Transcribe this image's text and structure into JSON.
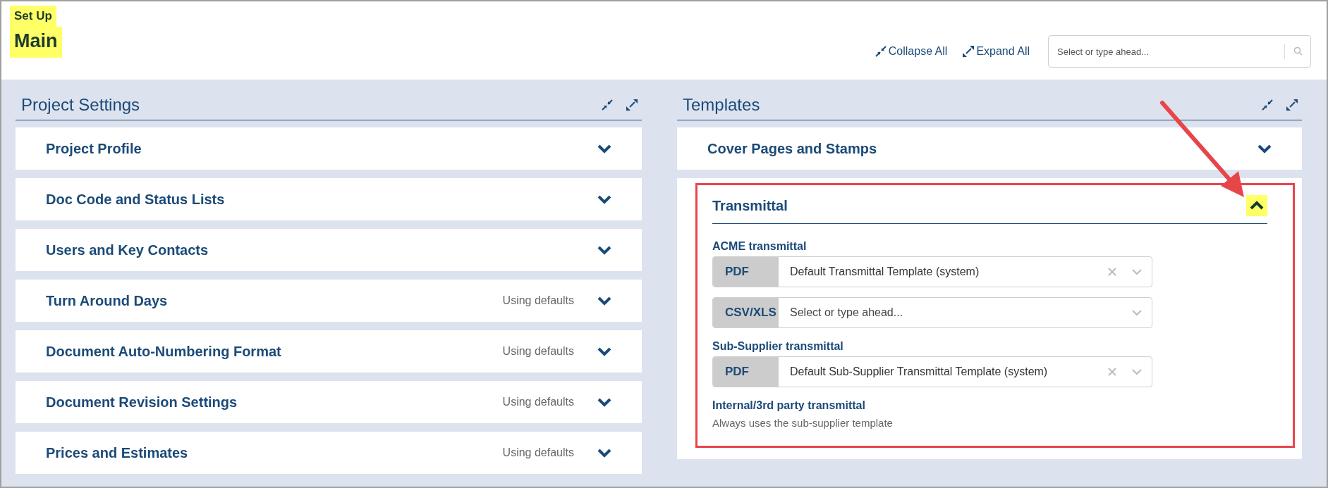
{
  "header": {
    "breadcrumb": "Set Up",
    "title": "Main",
    "actions": [
      {
        "label": "Collapse All",
        "kind": "collapse"
      },
      {
        "label": "Expand All",
        "kind": "expand"
      }
    ],
    "search": {
      "placeholder": "Select or type ahead..."
    }
  },
  "panels": [
    {
      "title": "Project Settings",
      "sections": [
        {
          "title": "Project Profile",
          "expanded": false
        },
        {
          "title": "Doc Code and Status Lists",
          "expanded": false
        },
        {
          "title": "Users and Key Contacts",
          "expanded": false
        },
        {
          "title": "Turn Around Days",
          "status": "Using defaults",
          "expanded": false
        },
        {
          "title": "Document Auto-Numbering Format",
          "status": "Using defaults",
          "expanded": false
        },
        {
          "title": "Document Revision Settings",
          "status": "Using defaults",
          "expanded": false
        },
        {
          "title": "Prices and Estimates",
          "status": "Using defaults",
          "expanded": false
        }
      ]
    },
    {
      "title": "Templates",
      "sections": [
        {
          "title": "Cover Pages and Stamps",
          "expanded": false
        },
        {
          "title": "Transmittal",
          "expanded": true,
          "groups": [
            {
              "label": "ACME transmittal",
              "selects": [
                {
                  "tag": "PDF",
                  "value": "Default Transmittal Template (system)",
                  "clearable": true
                },
                {
                  "tag": "CSV/XLS",
                  "placeholder": "Select or type ahead...",
                  "clearable": false
                }
              ]
            },
            {
              "label": "Sub-Supplier transmittal",
              "selects": [
                {
                  "tag": "PDF",
                  "value": "Default Sub-Supplier Transmittal Template (system)",
                  "clearable": true
                }
              ]
            },
            {
              "label": "Internal/3rd party transmittal",
              "note": "Always uses the sub-supplier template"
            }
          ]
        }
      ]
    }
  ]
}
